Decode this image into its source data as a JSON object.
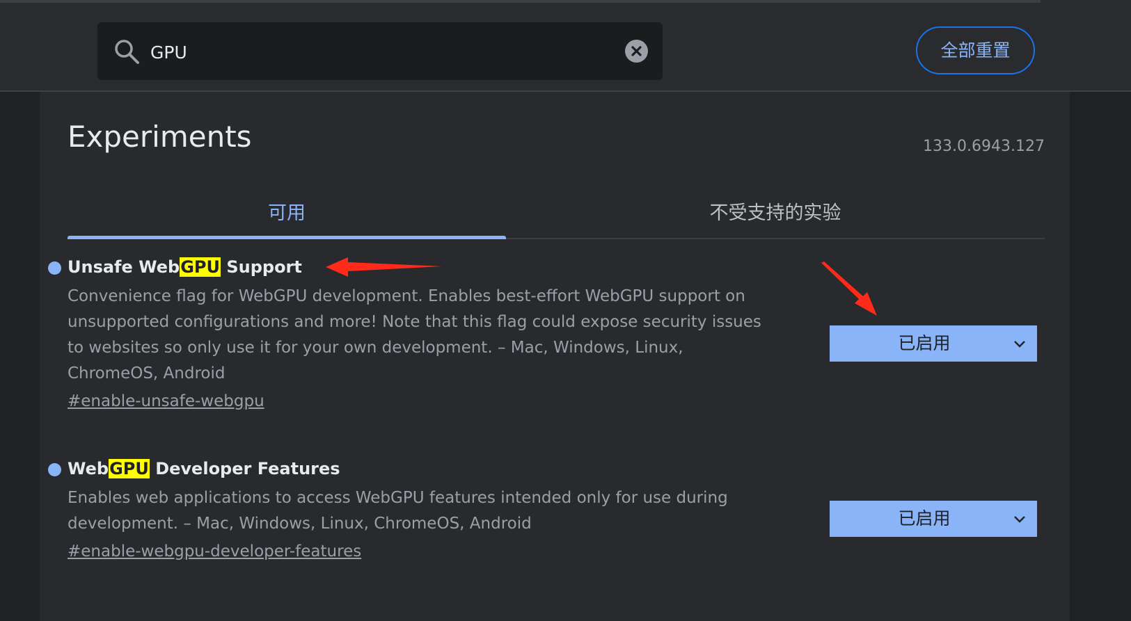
{
  "search": {
    "value": "GPU",
    "placeholder": "",
    "reset_label": "全部重置"
  },
  "page": {
    "title": "Experiments",
    "version": "133.0.6943.127"
  },
  "tabs": [
    {
      "label": "可用",
      "active": true
    },
    {
      "label": "不受支持的实验",
      "active": false
    }
  ],
  "experiments": [
    {
      "title_pre": "Unsafe Web",
      "title_hl": "GPU",
      "title_post": " Support",
      "description": "Convenience flag for WebGPU development. Enables best-effort WebGPU support on unsupported configurations and more! Note that this flag could expose security issues to websites so only use it for your own development. – Mac, Windows, Linux, ChromeOS, Android",
      "link": "#enable-unsafe-webgpu",
      "selected": "已启用"
    },
    {
      "title_pre": "Web",
      "title_hl": "GPU",
      "title_post": " Developer Features",
      "description": "Enables web applications to access WebGPU features intended only for use during development. – Mac, Windows, Linux, ChromeOS, Android",
      "link": "#enable-webgpu-developer-features",
      "selected": "已启用"
    }
  ],
  "colors": {
    "accent": "#8ab4f8",
    "highlight": "#ffff00",
    "annotation_arrow": "#ff2a1a",
    "background": "#202124",
    "panel": "#292a2d"
  }
}
